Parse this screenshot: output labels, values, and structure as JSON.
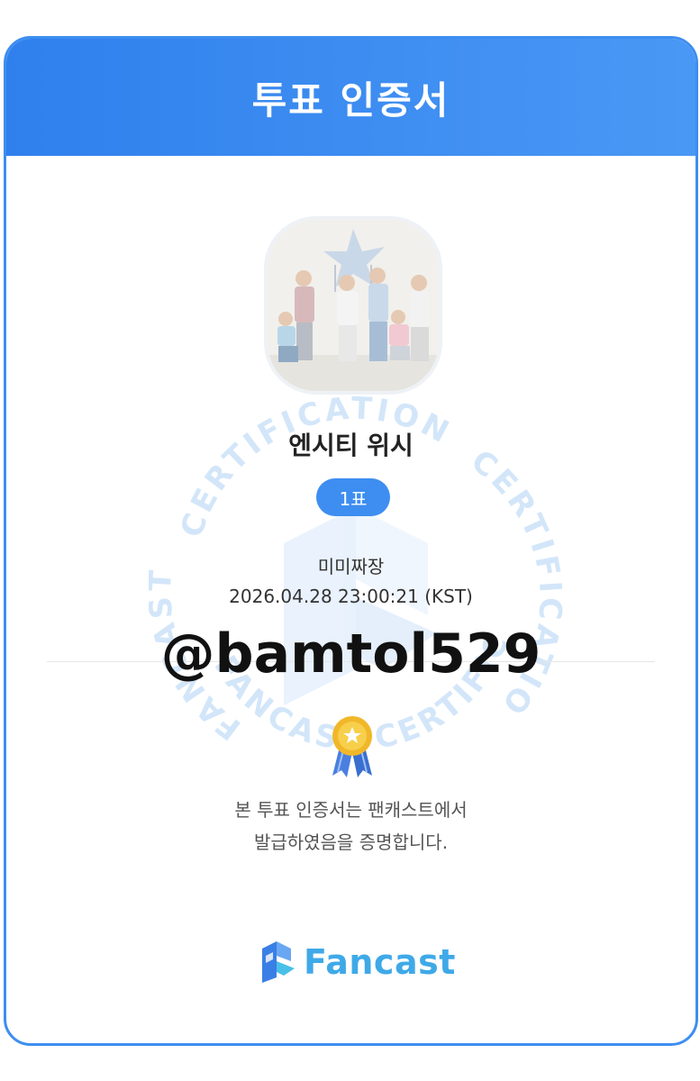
{
  "header": {
    "title": "투표 인증서"
  },
  "seal": {
    "top_text": "CERTIFICATION",
    "left_text": "FANCAST",
    "bottom_text": "FANCAST CERTIFICATION",
    "right_text": "CERTIFICATION",
    "color": "#cfe3f8"
  },
  "artist": {
    "name": "엔시티 위시",
    "photo": "group-photo"
  },
  "vote": {
    "count_label": "1표"
  },
  "voter": {
    "name": "미미짜장",
    "timestamp": "2026.04.28 23:00:21 (KST)"
  },
  "overlay": {
    "handle": "@bamtol529"
  },
  "certification": {
    "line1": "본 투표 인증서는 팬캐스트에서",
    "line2": "발급하였음을 증명합니다."
  },
  "brand": {
    "name": "Fancast",
    "accent": "#3d8ef0",
    "logo_color": "#3fa9e8"
  }
}
